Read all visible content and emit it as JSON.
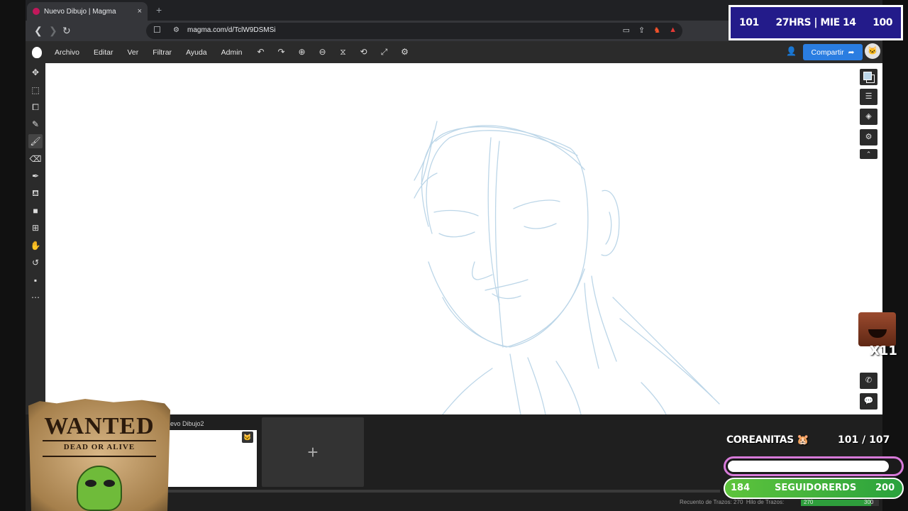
{
  "browser": {
    "tab_title": "Nuevo Dibujo | Magma",
    "tab_close": "×",
    "new_tab": "+",
    "back": "❮",
    "forward": "❯",
    "reload": "↻",
    "url": "magma.com/d/TclW9DSMSi",
    "bookmark_icon": "bookmark-icon",
    "extension_icons": [
      "cast-icon",
      "share-icon",
      "brave-lion-icon",
      "brave-rewards-icon"
    ]
  },
  "app": {
    "menu": [
      "Archivo",
      "Editar",
      "Ver",
      "Filtrar",
      "Ayuda",
      "Admin"
    ],
    "toolbar_actions": [
      "undo-icon",
      "redo-icon",
      "zoom-in-icon",
      "zoom-out-icon",
      "flip-icon",
      "rotate-icon",
      "fullscreen-icon",
      "settings-icon"
    ],
    "share_label": "Compartir",
    "left_tools": [
      "move-icon",
      "selection-icon",
      "transform-icon",
      "eyedropper-icon",
      "brush-icon",
      "eraser-icon",
      "pen-icon",
      "fill-icon",
      "shape-icon",
      "add-icon",
      "hand-icon",
      "rotate-view-icon",
      "comment-icon",
      "more-icon"
    ],
    "active_tool": "brush-icon",
    "right_panel": [
      "color-icon",
      "layers-list-icon",
      "layers-icon",
      "settings-icon",
      "collapse-icon"
    ],
    "right_bottom": [
      "phone-icon",
      "chat-icon"
    ],
    "colors": {
      "stroke": "#bcd6e8",
      "accent": "#2a7de1"
    }
  },
  "documents": {
    "thumb_label": "uevo Dibujo2",
    "add_label": "+"
  },
  "status": {
    "stroke_count": "Recuento de Trazos: 270",
    "thread_label": "Hilo de Trazos:",
    "thread_value": "270",
    "thread_max": "300",
    "thread_fraction": 0.9
  },
  "overlay": {
    "stream": {
      "left": "101",
      "center": "27HRS | MIE 14",
      "right": "100"
    },
    "wanted_title": "WANTED",
    "wanted_sub": "DEAD OR ALIVE",
    "emote_label": "X11",
    "coreanitas_label": "COREANITAS 🐹",
    "coreanitas_count": "101  / 107",
    "coreanitas_fraction": 0.94,
    "seg_min": "184",
    "seg_label": "SEGUIDORERDS",
    "seg_max": "200",
    "colors": {
      "stream_bg": "#231b8a",
      "goal_border": "#d77ad9",
      "seg_green": "#5ec43c"
    }
  }
}
